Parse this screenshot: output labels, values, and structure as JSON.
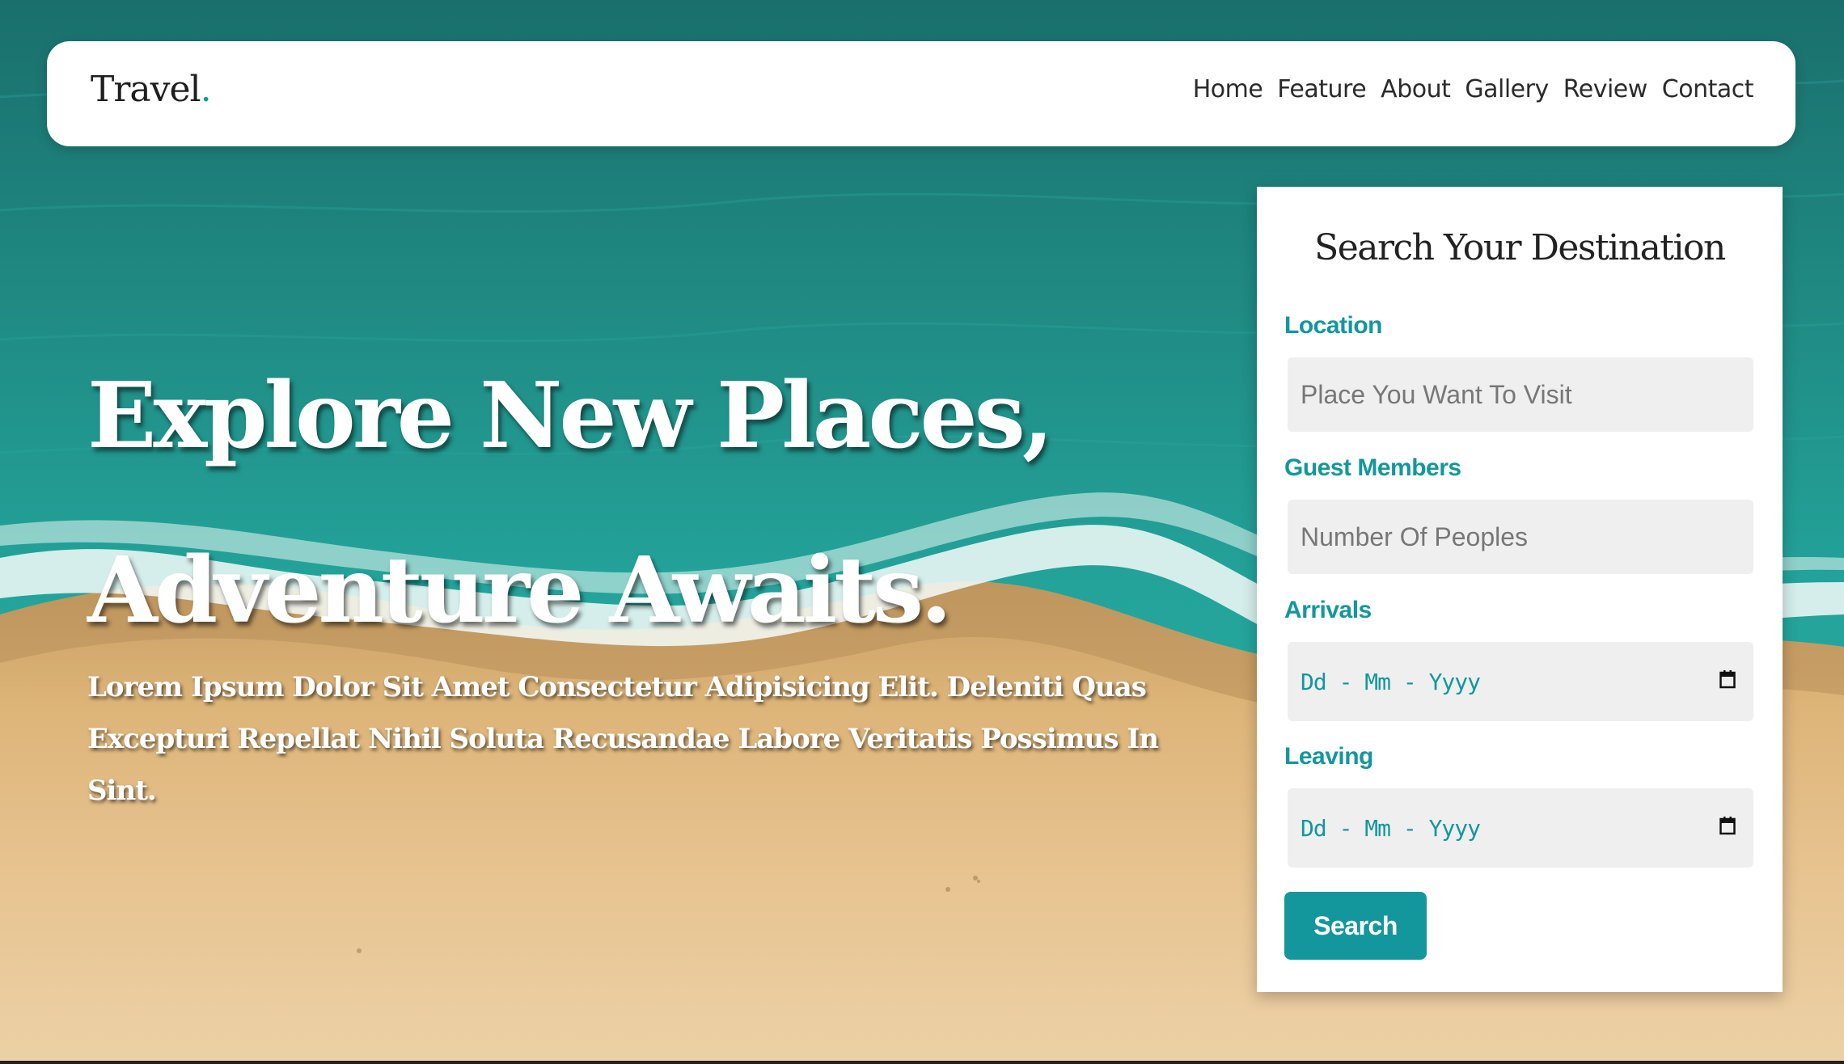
{
  "navbar": {
    "logo_text": "Travel",
    "logo_dot": ".",
    "links": [
      "Home",
      "Feature",
      "About",
      "Gallery",
      "Review",
      "Contact"
    ]
  },
  "hero": {
    "title_line1": "Explore New Places,",
    "title_line2": "Adventure Awaits.",
    "description": "Lorem Ipsum Dolor Sit Amet Consectetur Adipisicing Elit. Deleniti Quas Excepturi Repellat Nihil Soluta Recusandae Labore Veritatis Possimus In Sint."
  },
  "search_panel": {
    "title": "Search Your Destination",
    "location": {
      "label": "Location",
      "placeholder": "Place You Want To Visit"
    },
    "guests": {
      "label": "Guest Members",
      "placeholder": "Number Of Peoples"
    },
    "arrivals": {
      "label": "Arrivals",
      "placeholder": "Dd - Mm - Yyyy"
    },
    "leaving": {
      "label": "Leaving",
      "placeholder": "Dd - Mm - Yyyy"
    },
    "button_label": "Search"
  },
  "colors": {
    "accent": "#13979c",
    "sea": "#1d8f8a",
    "sand": "#e3bd86"
  },
  "icons": {
    "calendar": "calendar-icon"
  }
}
